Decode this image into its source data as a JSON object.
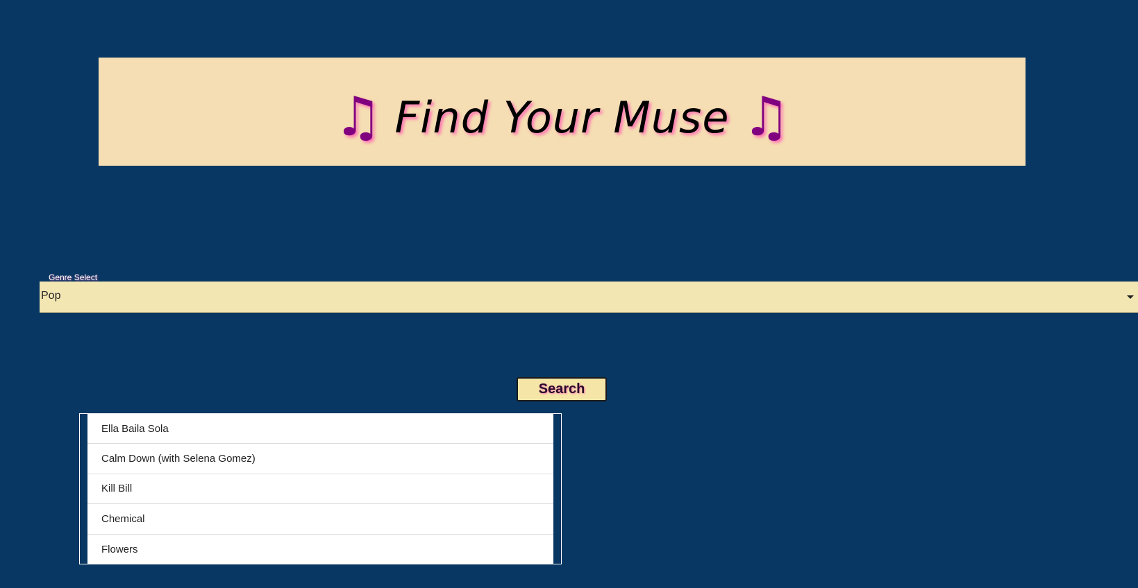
{
  "banner": {
    "title": "Find Your Muse",
    "left_icon": "♫",
    "right_icon": "♫",
    "icon_name": "music-note-icon",
    "background": "#f5deb3",
    "icon_color": "#800080"
  },
  "genre": {
    "label": "Genre Select",
    "value": "Pop"
  },
  "search": {
    "label": "Search"
  },
  "results": [
    "Ella Baila Sola",
    "Calm Down (with Selena Gomez)",
    "Kill Bill",
    "Chemical",
    "Flowers"
  ],
  "colors": {
    "page_background": "#083763",
    "select_background": "#f2e6b3",
    "button_background": "#f5e6a8"
  }
}
